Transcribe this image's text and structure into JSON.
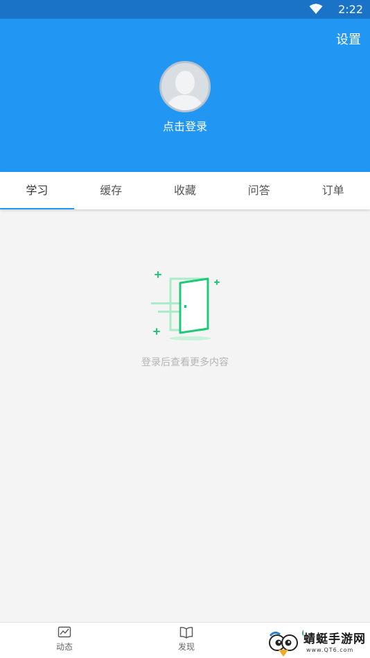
{
  "status_bar": {
    "time": "2:22",
    "icons": [
      "wifi-icon"
    ]
  },
  "header": {
    "settings_label": "设置",
    "login_label": "点击登录",
    "colors": {
      "background": "#2196f3",
      "status_bar": "#1a73c7"
    }
  },
  "tabs": [
    {
      "label": "学习",
      "active": true
    },
    {
      "label": "缓存",
      "active": false
    },
    {
      "label": "收藏",
      "active": false
    },
    {
      "label": "问答",
      "active": false
    },
    {
      "label": "订单",
      "active": false
    }
  ],
  "empty_state": {
    "icon": "door-icon",
    "message": "登录后查看更多内容",
    "accent": "#1ec978"
  },
  "bottom_nav": [
    {
      "label": "动态",
      "icon": "trend-chart-icon"
    },
    {
      "label": "发现",
      "icon": "book-icon"
    }
  ],
  "watermark": {
    "title": "蜻蜓手游网",
    "url": "www.QT6.com"
  }
}
